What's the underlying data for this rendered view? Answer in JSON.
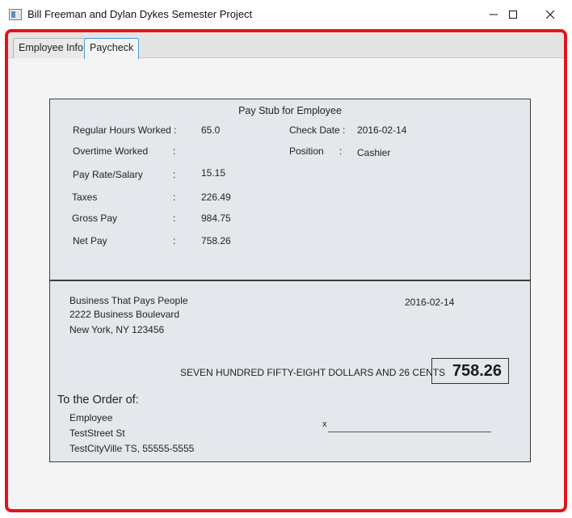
{
  "window": {
    "title": "Bill Freeman and Dylan Dykes Semester Project"
  },
  "tabs": [
    {
      "label": "Employee Info"
    },
    {
      "label": "Paycheck"
    }
  ],
  "stub": {
    "heading": "Pay Stub for Employee",
    "regular_hours": {
      "label": "Regular Hours Worked :",
      "value": "65.0"
    },
    "overtime": {
      "label": "Overtime Worked",
      "colon": ":",
      "value": ""
    },
    "pay_rate": {
      "label": "Pay Rate/Salary",
      "colon": ":",
      "value": "15.15"
    },
    "taxes": {
      "label": "Taxes",
      "colon": ":",
      "value": "226.49"
    },
    "gross": {
      "label": "Gross Pay",
      "colon": ":",
      "value": "984.75"
    },
    "net": {
      "label": "Net Pay",
      "colon": ":",
      "value": "758.26"
    },
    "check_date": {
      "label": "Check Date :",
      "value": "2016-02-14"
    },
    "position": {
      "label": "Position",
      "colon": ":",
      "value": "Cashier"
    }
  },
  "check": {
    "business_name": "Business That Pays People",
    "business_street": "2222 Business Boulevard",
    "business_city": "New York, NY 123456",
    "date": "2016-02-14",
    "amount_words": "SEVEN HUNDRED FIFTY-EIGHT DOLLARS AND 26 CENTS",
    "amount": "758.26",
    "order_label": "To the Order of:",
    "payee_name": "Employee",
    "payee_street": "TestStreet St",
    "payee_city": "TestCityVille TS, 55555-5555",
    "signature_mark": "x"
  },
  "icons": {
    "app": "app-window-icon",
    "minimize": "minimize-icon",
    "maximize": "maximize-icon",
    "close": "close-icon"
  },
  "colors": {
    "frame_border": "#e3141d",
    "active_tab": "#3ea0d8",
    "panel_bg": "#e4e8ec"
  }
}
